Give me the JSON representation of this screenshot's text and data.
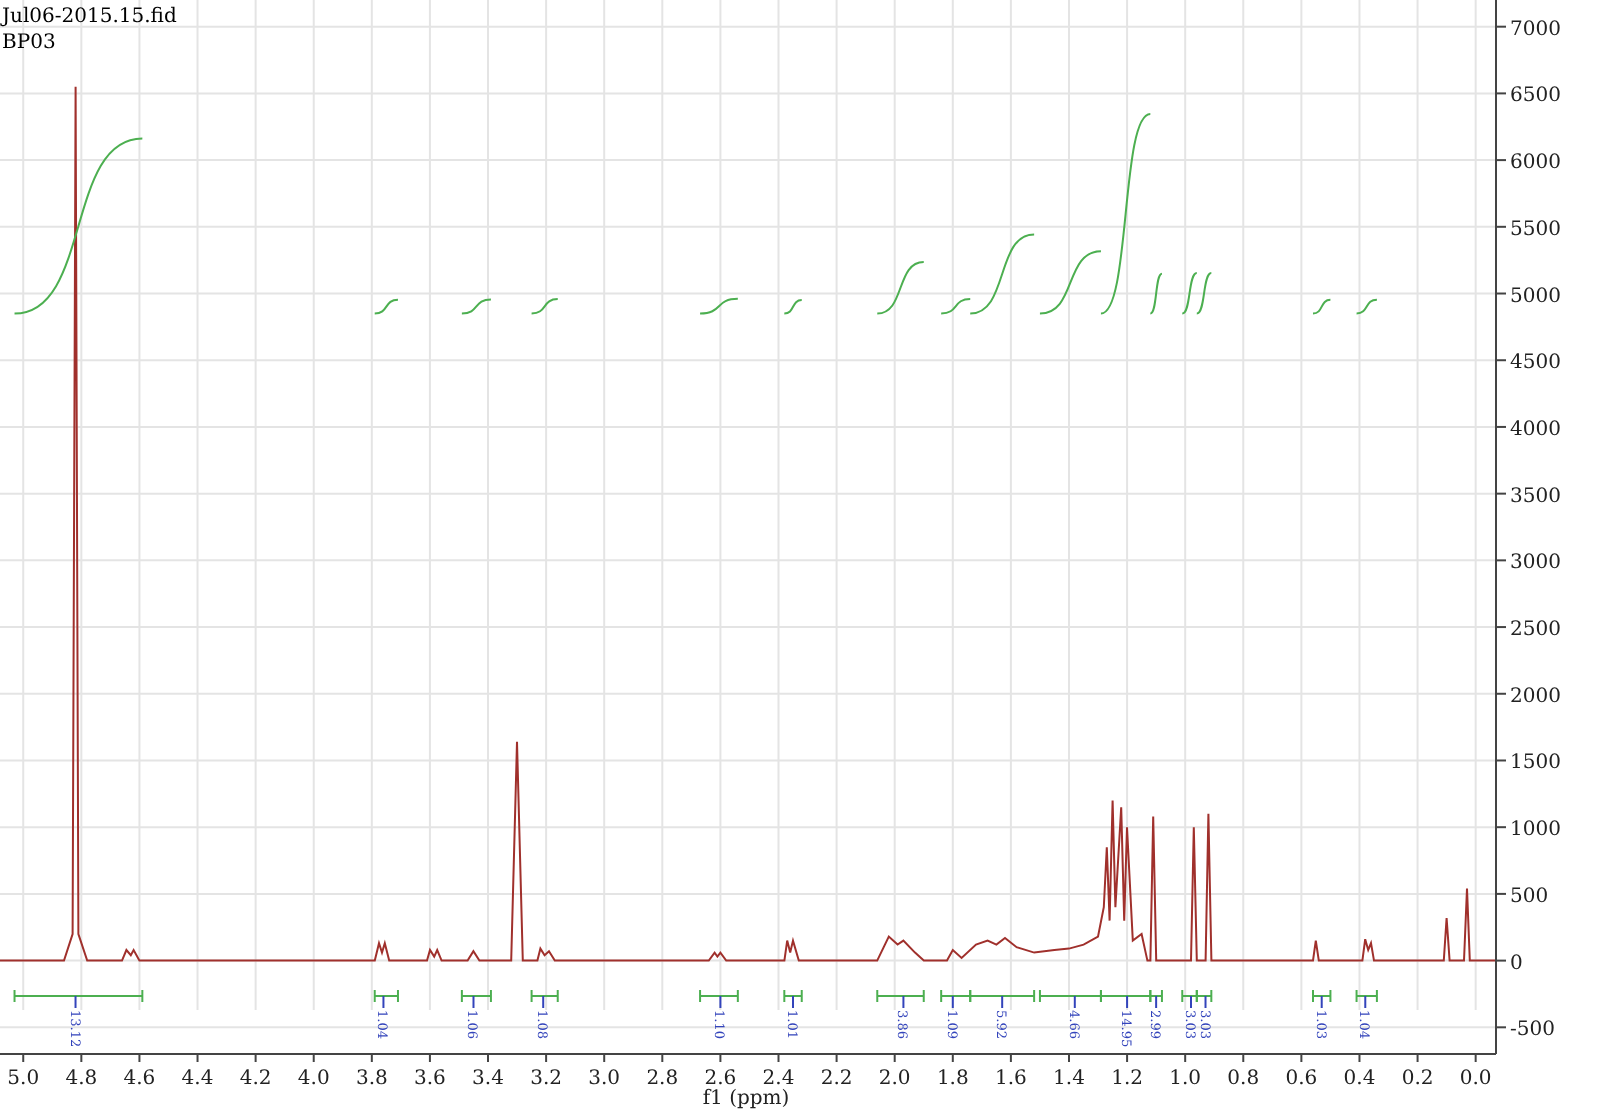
{
  "header": {
    "lines": [
      "Jul06-2015.15.fid",
      "BP03"
    ]
  },
  "chart_data": {
    "type": "line",
    "xlabel": "f1 (ppm)",
    "xlim": [
      5.08,
      -0.07
    ],
    "ylim": [
      -700,
      7200
    ],
    "grid": true,
    "xticks": [
      {
        "value": 5,
        "label": "5.0"
      },
      4.8,
      4.6,
      4.4,
      4.2,
      {
        "value": 4,
        "label": "4.0"
      },
      3.8,
      3.6,
      3.4,
      3.2,
      {
        "value": 3,
        "label": "3.0"
      },
      2.8,
      2.6,
      2.4,
      2.2,
      {
        "value": 2,
        "label": "2.0"
      },
      1.8,
      1.6,
      1.4,
      1.2,
      {
        "value": 1,
        "label": "1.0"
      },
      0.8,
      0.6,
      0.4,
      0.2,
      {
        "value": 0,
        "label": "0.0"
      }
    ],
    "yticks": [
      -500,
      0,
      500,
      1000,
      1500,
      2000,
      2500,
      3000,
      3500,
      4000,
      4500,
      5000,
      5500,
      6000,
      6500,
      7000
    ],
    "x": [
      5.08,
      4.86,
      4.83,
      4.82,
      4.81,
      4.78,
      4.66,
      4.645,
      4.63,
      4.62,
      4.6,
      3.79,
      3.775,
      3.765,
      3.755,
      3.74,
      3.61,
      3.6,
      3.585,
      3.575,
      3.56,
      3.47,
      3.45,
      3.43,
      3.32,
      3.3,
      3.28,
      3.23,
      3.22,
      3.205,
      3.19,
      3.17,
      2.64,
      2.62,
      2.61,
      2.6,
      2.58,
      2.38,
      2.37,
      2.36,
      2.35,
      2.33,
      2.06,
      2.02,
      1.99,
      1.97,
      1.93,
      1.9,
      1.82,
      1.8,
      1.77,
      1.72,
      1.68,
      1.65,
      1.62,
      1.58,
      1.52,
      1.45,
      1.4,
      1.35,
      1.3,
      1.28,
      1.27,
      1.26,
      1.25,
      1.24,
      1.22,
      1.21,
      1.2,
      1.18,
      1.15,
      1.13,
      1.12,
      1.11,
      1.1,
      0.98,
      0.97,
      0.96,
      0.93,
      0.92,
      0.91,
      0.56,
      0.55,
      0.54,
      0.39,
      0.38,
      0.37,
      0.36,
      0.35,
      0.11,
      0.1,
      0.09,
      0.04,
      0.03,
      0.02,
      -0.07
    ],
    "series": [
      {
        "color": "#a0302c",
        "values": [
          0,
          0,
          200,
          6550,
          200,
          0,
          0,
          80,
          40,
          80,
          0,
          0,
          130,
          60,
          130,
          0,
          0,
          80,
          30,
          80,
          0,
          0,
          70,
          0,
          0,
          1640,
          0,
          0,
          90,
          40,
          70,
          0,
          0,
          60,
          30,
          60,
          0,
          0,
          150,
          60,
          150,
          0,
          0,
          180,
          120,
          150,
          60,
          0,
          0,
          80,
          20,
          120,
          150,
          120,
          170,
          100,
          60,
          80,
          90,
          120,
          180,
          400,
          850,
          300,
          1200,
          400,
          1150,
          300,
          1000,
          150,
          200,
          0,
          0,
          1080,
          0,
          0,
          1000,
          0,
          0,
          1100,
          0,
          0,
          150,
          0,
          0,
          160,
          80,
          130,
          0,
          0,
          320,
          0,
          0,
          540,
          0,
          0
        ]
      }
    ],
    "annotations": [
      "13.12",
      "1.04",
      "1.06",
      "1.08",
      "1.10",
      "1.01",
      "3.86",
      "1.09",
      "5.92",
      "4.66",
      "14.95",
      "2.99",
      "3.03",
      "3.03",
      "1.03",
      "1.04"
    ]
  }
}
